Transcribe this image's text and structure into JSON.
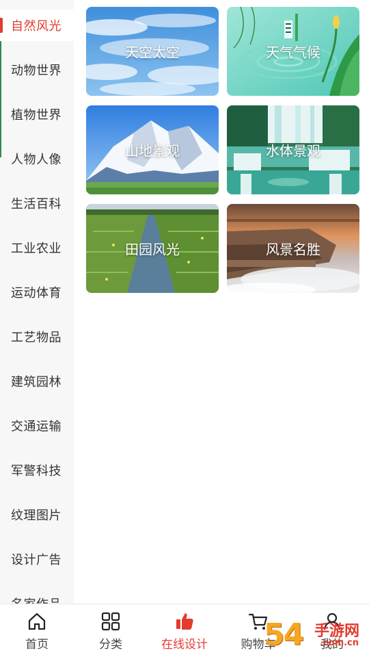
{
  "sidebar": {
    "items": [
      {
        "label": "自然风光"
      },
      {
        "label": "动物世界"
      },
      {
        "label": "植物世界"
      },
      {
        "label": "人物人像"
      },
      {
        "label": "生活百科"
      },
      {
        "label": "工业农业"
      },
      {
        "label": "运动体育"
      },
      {
        "label": "工艺物品"
      },
      {
        "label": "建筑园林"
      },
      {
        "label": "交通运输"
      },
      {
        "label": "军警科技"
      },
      {
        "label": "纹理图片"
      },
      {
        "label": "设计广告"
      },
      {
        "label": "名家作品"
      }
    ],
    "active_color": "#e23b2f"
  },
  "categories": [
    {
      "label": "天空太空"
    },
    {
      "label": "天气气候"
    },
    {
      "label": "山地景观"
    },
    {
      "label": "水体景观"
    },
    {
      "label": "田园风光"
    },
    {
      "label": "风景名胜"
    }
  ],
  "tabbar": {
    "tabs": [
      {
        "label": "首页",
        "icon": "home-icon"
      },
      {
        "label": "分类",
        "icon": "grid-icon"
      },
      {
        "label": "在线设计",
        "icon": "thumbs-up-icon"
      },
      {
        "label": "购物车",
        "icon": "cart-icon"
      },
      {
        "label": "我的",
        "icon": "user-icon"
      }
    ],
    "active_color": "#e23b2f"
  },
  "watermark": {
    "digits": "54",
    "cn": "手游网",
    "domain": ".com.cn"
  }
}
